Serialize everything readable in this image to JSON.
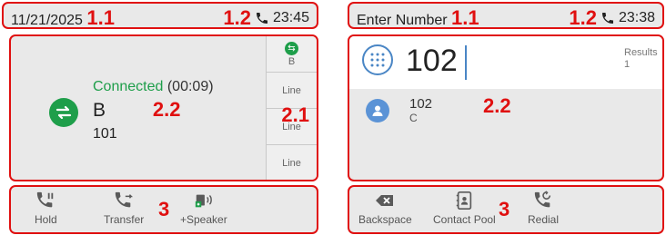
{
  "left_screen": {
    "status": {
      "date": "11/21/2025",
      "time": "23:45",
      "phone_icon": "phone-icon"
    },
    "annotations": {
      "status_left": "1.1",
      "status_right": "1.2",
      "line_keys": "2.1",
      "call_info": "2.2",
      "softkeys": "3"
    },
    "call": {
      "status": "Connected",
      "duration": "(00:09)",
      "name": "B",
      "number": "101"
    },
    "line_keys": [
      {
        "label": "B",
        "icon": "transfer-icon"
      },
      {
        "label": "Line"
      },
      {
        "label": "Line"
      },
      {
        "label": "Line"
      }
    ],
    "softkeys": [
      {
        "label": "Hold",
        "icon": "hold-icon"
      },
      {
        "label": "Transfer",
        "icon": "transfer-call-icon"
      },
      {
        "label": "+Speaker",
        "icon": "speaker-icon"
      }
    ]
  },
  "right_screen": {
    "status": {
      "title": "Enter Number",
      "time": "23:38",
      "phone_icon": "phone-icon"
    },
    "annotations": {
      "status_left": "1.1",
      "status_right": "1.2",
      "results": "2.2",
      "softkeys": "3"
    },
    "dial": {
      "value": "102",
      "results_label": "Results",
      "results_count": "1"
    },
    "result": {
      "number": "102",
      "sub": "C"
    },
    "softkeys": [
      {
        "label": "Backspace",
        "icon": "backspace-icon"
      },
      {
        "label": "Contact Pool",
        "icon": "contacts-icon"
      },
      {
        "label": "Redial",
        "icon": "redial-icon"
      }
    ]
  },
  "colors": {
    "annotation": "#e01010",
    "accent_green": "#1e9e4a",
    "accent_blue": "#4a86c5",
    "panel_bg": "#e9e9e9"
  }
}
